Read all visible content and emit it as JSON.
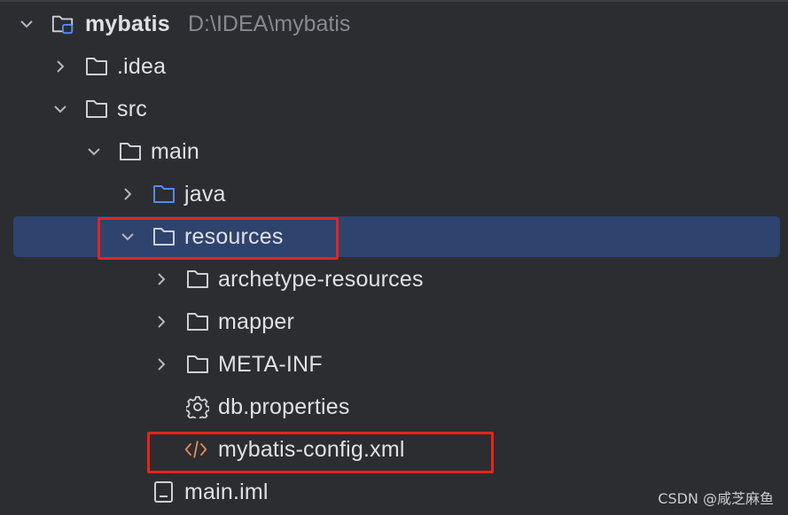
{
  "project_tree": {
    "root": {
      "name": "mybatis",
      "path": "D:\\IDEA\\mybatis"
    },
    "items": [
      {
        "label": ".idea",
        "icon": "folder-icon",
        "expanded": false
      },
      {
        "label": "src",
        "icon": "folder-icon",
        "expanded": true
      },
      {
        "label": "main",
        "icon": "folder-icon",
        "expanded": true
      },
      {
        "label": "java",
        "icon": "source-folder-icon",
        "expanded": false
      },
      {
        "label": "resources",
        "icon": "folder-icon",
        "expanded": true,
        "selected": true,
        "highlighted": true
      },
      {
        "label": "archetype-resources",
        "icon": "folder-icon",
        "expanded": false
      },
      {
        "label": "mapper",
        "icon": "folder-icon",
        "expanded": false
      },
      {
        "label": "META-INF",
        "icon": "folder-icon",
        "expanded": false
      },
      {
        "label": "db.properties",
        "icon": "gear-icon"
      },
      {
        "label": "mybatis-config.xml",
        "icon": "xml-code-icon",
        "highlighted": true
      },
      {
        "label": "main.iml",
        "icon": "iml-file-icon"
      }
    ]
  },
  "watermark": "CSDN @咸芝麻鱼",
  "colors": {
    "background": "#2b2d30",
    "selection": "#2e436e",
    "text": "#dfe1e5",
    "path_text": "#868a91",
    "highlight_box": "#e8231d",
    "java_folder": "#548af7",
    "xml_icon": "#e08855"
  }
}
